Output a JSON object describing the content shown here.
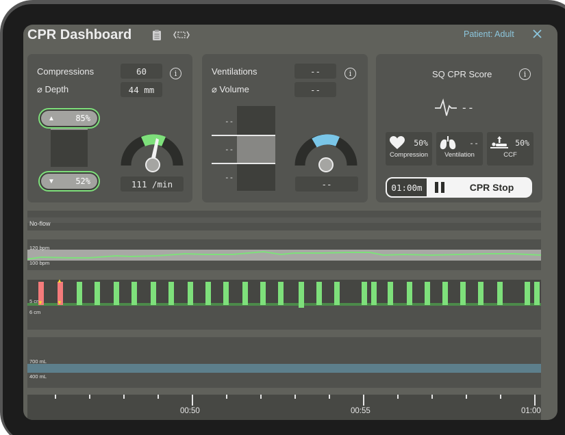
{
  "header": {
    "title": "CPR Dashboard",
    "patient": "Patient: Adult",
    "icons": [
      "clipboard-icon",
      "expand-brackets-icon",
      "close-icon"
    ]
  },
  "compressions": {
    "label": "Compressions",
    "value": "60",
    "depth_label": "⌀ Depth",
    "depth_value": "44 mm",
    "upper_percent": "85%",
    "lower_percent": "52%",
    "rate": "111 /min"
  },
  "ventilations": {
    "label": "Ventilations",
    "value": "--",
    "volume_label": "⌀ Volume",
    "volume_value": "--",
    "gauge_value": "--",
    "scale_labels": [
      "--",
      "--",
      "--"
    ]
  },
  "score": {
    "title": "SQ CPR Score",
    "value": "--",
    "cards": [
      {
        "icon": "heart-icon",
        "value": "50%",
        "caption": "Compression"
      },
      {
        "icon": "lungs-icon",
        "value": "--",
        "caption": "Ventilation"
      },
      {
        "icon": "cpr-person-icon",
        "value": "50%",
        "caption": "CCF"
      }
    ],
    "timer": "01:00m",
    "stop_label": "CPR Stop"
  },
  "timeline": {
    "noflow_label": "No-flow",
    "hr_high": "120 bpm",
    "hr_low": "100 bpm",
    "depth_upper": "5 cm",
    "depth_lower": "6 cm",
    "vol_high": "700 mL",
    "vol_low": "400 mL",
    "time_labels": [
      "00:50",
      "00:55",
      "01:00"
    ]
  },
  "colors": {
    "accent_green": "#7ee07b",
    "warn_red": "#f47b7b",
    "warn_yellow": "#f2dd2a",
    "vent_blue": "#7ac6e8",
    "band_blue": "#5d7f8c"
  }
}
